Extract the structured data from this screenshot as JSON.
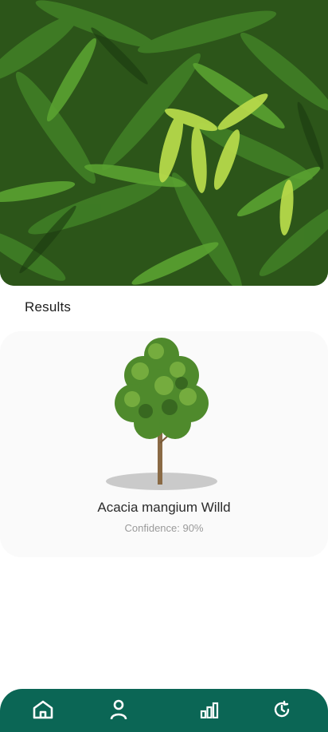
{
  "hero": {
    "image_icon": "leaf-photo"
  },
  "results": {
    "heading": "Results",
    "species_name": "Acacia mangium Willd",
    "confidence_text": "Confidence: 90%",
    "tree_icon": "tree-image"
  },
  "bottom_nav": {
    "background": "#0b6655",
    "items": [
      {
        "icon": "home-icon"
      },
      {
        "icon": "profile-icon"
      },
      {
        "icon": "stats-icon"
      },
      {
        "icon": "history-icon"
      }
    ]
  }
}
